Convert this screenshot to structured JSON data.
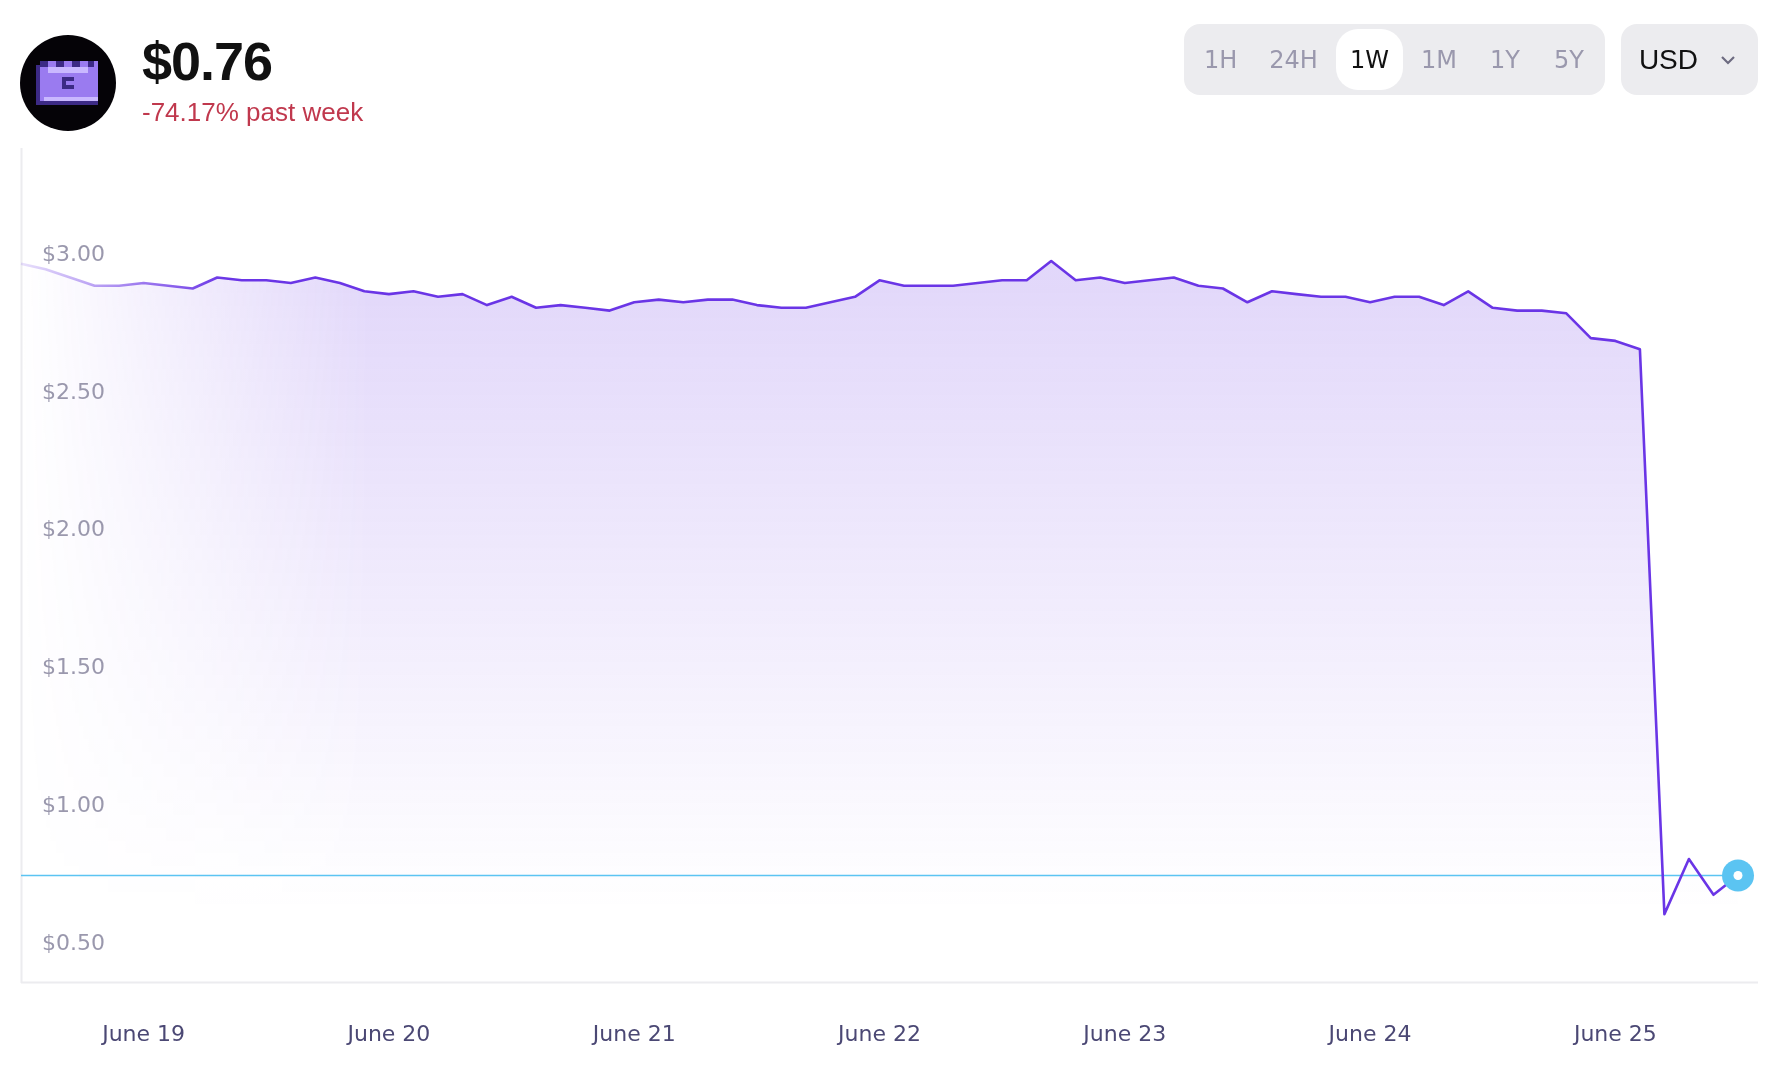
{
  "header": {
    "price": "$0.76",
    "change": "-74.17% past week"
  },
  "ranges": [
    {
      "label": "1H",
      "selected": false
    },
    {
      "label": "24H",
      "selected": false
    },
    {
      "label": "1W",
      "selected": true
    },
    {
      "label": "1M",
      "selected": false
    },
    {
      "label": "1Y",
      "selected": false
    },
    {
      "label": "5Y",
      "selected": false
    }
  ],
  "currency": {
    "label": "USD"
  },
  "chart": {
    "chart_data": {
      "type": "area",
      "categories": [
        null,
        null,
        null,
        null,
        null,
        "June 19",
        null,
        null,
        null,
        null,
        null,
        null,
        null,
        null,
        null,
        "June 20",
        null,
        null,
        null,
        null,
        null,
        null,
        null,
        null,
        null,
        "June 21",
        null,
        null,
        null,
        null,
        null,
        null,
        null,
        null,
        null,
        "June 22",
        null,
        null,
        null,
        null,
        null,
        null,
        null,
        null,
        null,
        "June 23",
        null,
        null,
        null,
        null,
        null,
        null,
        null,
        null,
        null,
        "June 24",
        null,
        null,
        null,
        null,
        null,
        null,
        null,
        null,
        null,
        "June 25",
        null,
        null,
        null,
        null,
        null
      ],
      "series": [
        {
          "color": "#6a35e6",
          "values": [
            2.96,
            2.94,
            2.91,
            2.88,
            2.88,
            2.89,
            2.88,
            2.87,
            2.91,
            2.9,
            2.9,
            2.89,
            2.91,
            2.89,
            2.86,
            2.85,
            2.86,
            2.84,
            2.85,
            2.81,
            2.84,
            2.8,
            2.81,
            2.8,
            2.79,
            2.82,
            2.83,
            2.82,
            2.83,
            2.83,
            2.81,
            2.8,
            2.8,
            2.82,
            2.84,
            2.9,
            2.88,
            2.88,
            2.88,
            2.89,
            2.9,
            2.9,
            2.97,
            2.9,
            2.91,
            2.89,
            2.9,
            2.91,
            2.88,
            2.87,
            2.82,
            2.86,
            2.85,
            2.84,
            2.84,
            2.82,
            2.84,
            2.84,
            2.81,
            2.86,
            2.8,
            2.79,
            2.79,
            2.78,
            2.69,
            2.68,
            2.65,
            0.6,
            0.8,
            0.67,
            0.74
          ]
        },
        {
          "color": "#5bc4f2",
          "type": "line",
          "values": [
            0.74,
            0.74,
            0.74,
            0.74,
            0.74,
            0.74,
            0.74,
            0.74,
            0.74,
            0.74,
            0.74,
            0.74,
            0.74,
            0.74,
            0.74,
            0.74,
            0.74,
            0.74,
            0.74,
            0.74,
            0.74,
            0.74,
            0.74,
            0.74,
            0.74,
            0.74,
            0.74,
            0.74,
            0.74,
            0.74,
            0.74,
            0.74,
            0.74,
            0.74,
            0.74,
            0.74,
            0.74,
            0.74,
            0.74,
            0.74,
            0.74,
            0.74,
            0.74,
            0.74,
            0.74,
            0.74,
            0.74,
            0.74,
            0.74,
            0.74,
            0.74,
            0.74,
            0.74,
            0.74,
            0.74,
            0.74,
            0.74,
            0.74,
            0.74,
            0.74,
            0.74,
            0.74,
            0.74,
            0.74,
            0.74,
            0.74,
            0.74,
            0.74,
            0.74,
            0.74,
            0.74
          ]
        }
      ],
      "ylim": [
        0.35,
        3.38
      ],
      "yticks": [
        {
          "value": 3,
          "label": "$3.00"
        },
        {
          "value": 2.5,
          "label": "$2.50"
        },
        {
          "value": 2,
          "label": "$2.00"
        },
        {
          "value": 1.5,
          "label": "$1.50"
        },
        {
          "value": 1,
          "label": "$1.00"
        },
        {
          "value": 0.5,
          "label": "$0.50"
        }
      ]
    }
  }
}
